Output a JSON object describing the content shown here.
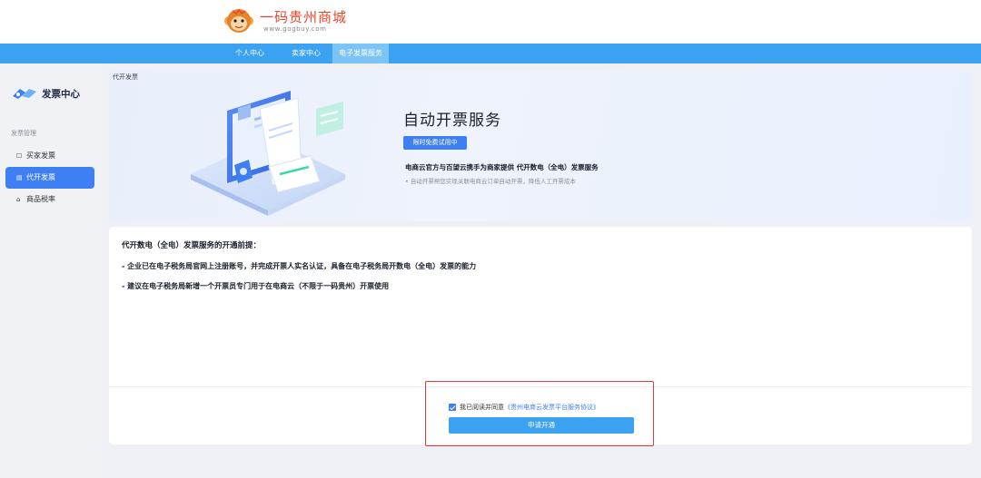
{
  "header": {
    "logo_title": "一码贵州商城",
    "logo_sub": "www.gogbuy.com"
  },
  "nav": {
    "items": [
      {
        "label": "个人中心",
        "active": false
      },
      {
        "label": "卖家中心",
        "active": false
      },
      {
        "label": "电子发票服务",
        "active": true
      }
    ]
  },
  "sidebar": {
    "brand": "发票中心",
    "group_label": "发票管理",
    "items": [
      {
        "label": "买家发票",
        "icon": "document-icon",
        "active": false
      },
      {
        "label": "代开发票",
        "icon": "invoice-icon",
        "active": true
      },
      {
        "label": "商品税率",
        "icon": "tax-icon",
        "active": false
      }
    ]
  },
  "banner": {
    "breadcrumb": "代开发票",
    "title": "自动开票服务",
    "badge": "限时免费试用中",
    "subtitle": "电商云官方与百望云携手为商家提供 代开数电（全电）发票服务",
    "note": "• 自动开票帮您实现关联电商云订单自动开票，降低人工开票成本"
  },
  "content": {
    "prereq_title": "代开数电（全电）发票服务的开通前提：",
    "prereq_items": [
      "- 企业已在电子税务局官网上注册账号，并完成开票人实名认证，具备在电子税务局开数电（全电）发票的能力",
      "- 建议在电子税务局新增一个开票员专门用于在电商云（不限于一码贵州）开票使用"
    ],
    "agreement_text": "我已阅读并同意",
    "agreement_link": "《贵州电商云发票平台服务协议》",
    "agreement_checked": true,
    "apply_button": "申请开通"
  },
  "colors": {
    "primary": "#3f7ff4",
    "nav_bar": "#3ba2f2",
    "highlight": "#e03a3a",
    "logo": "#e8462a"
  }
}
